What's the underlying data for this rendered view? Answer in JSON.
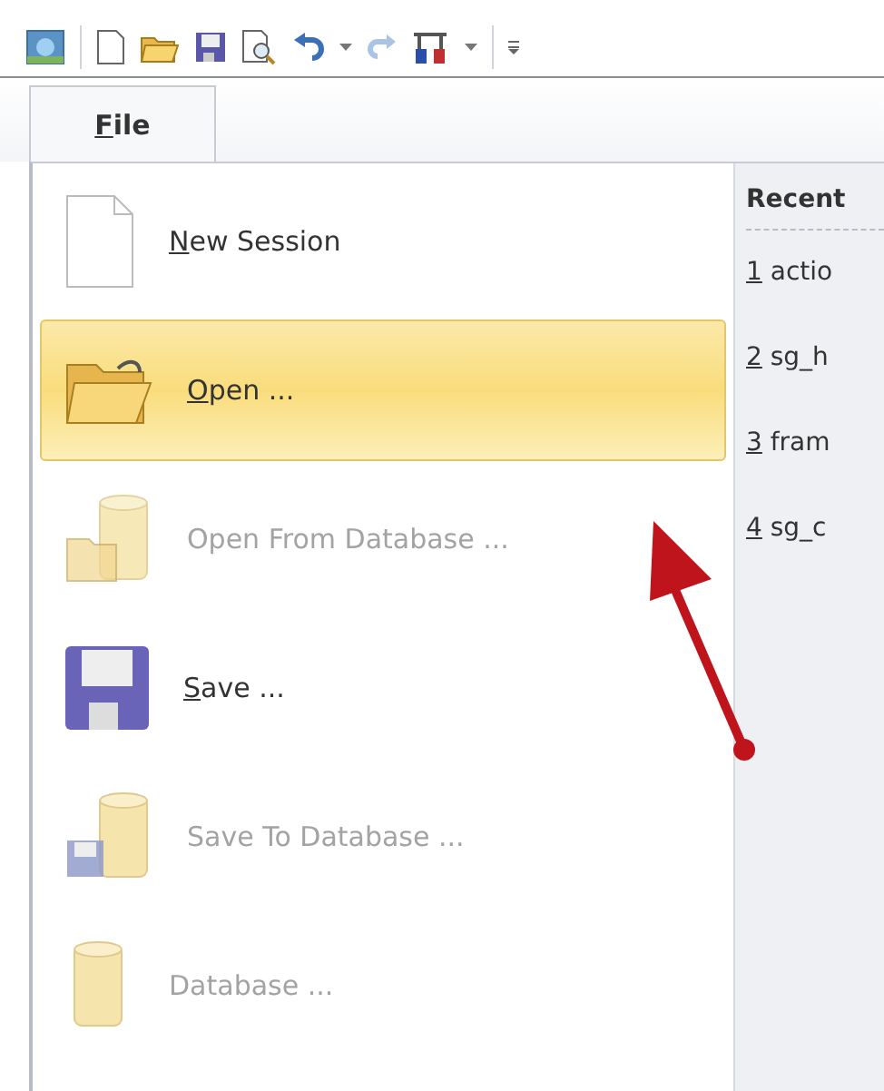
{
  "ribbon_tabs": [
    {
      "key": "F",
      "rest": "ile",
      "selected": true
    }
  ],
  "menu_items": [
    {
      "kind": "document",
      "key": "N",
      "rest": "ew Session",
      "disabled": false,
      "selected": false
    },
    {
      "kind": "folder",
      "key": "O",
      "rest": "pen ...",
      "disabled": false,
      "selected": true
    },
    {
      "kind": "database-open",
      "rest": "Open From Database ...",
      "disabled": true,
      "selected": false
    },
    {
      "kind": "save",
      "key": "S",
      "rest": "ave ...",
      "disabled": false,
      "selected": false
    },
    {
      "kind": "database-save",
      "rest": "Save To Database ...",
      "disabled": true,
      "selected": false
    },
    {
      "kind": "database",
      "rest": "Database ...",
      "disabled": true,
      "selected": false
    }
  ],
  "recent": {
    "title": "Recent",
    "files": [
      {
        "key": "1",
        "rest": " actio"
      },
      {
        "key": "2",
        "rest": " sg_h"
      },
      {
        "key": "3",
        "rest": " fram"
      },
      {
        "key": "4",
        "rest": " sg_c"
      }
    ]
  }
}
